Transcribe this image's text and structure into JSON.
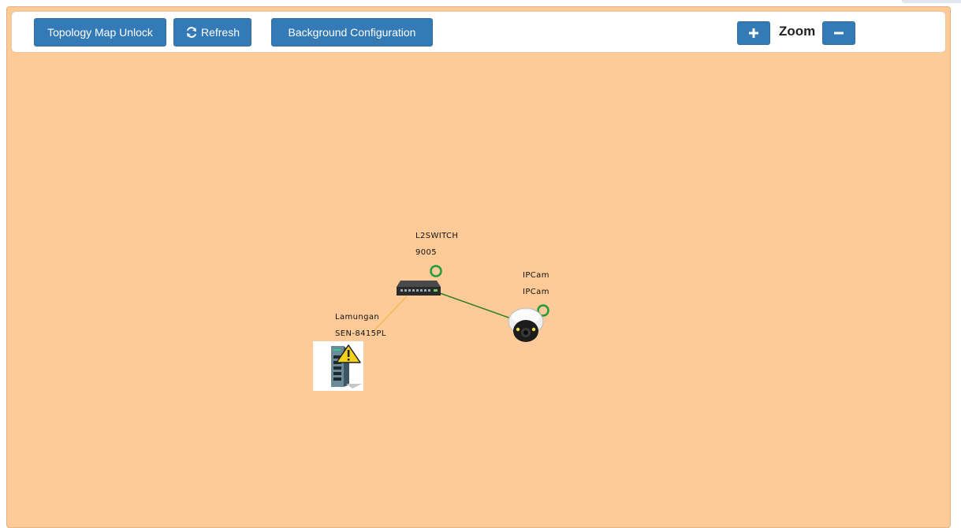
{
  "toolbar": {
    "topology_unlock_label": "Topology Map Unlock",
    "refresh_label": "Refresh",
    "background_config_label": "Background Configuration",
    "zoom_label": "Zoom",
    "zoom_in_icon": "plus-icon",
    "zoom_out_icon": "minus-icon",
    "refresh_icon": "refresh-icon"
  },
  "colors": {
    "canvas_background": "#fecb98",
    "button": "#337ab7",
    "status_ok": "#1e9b3c",
    "link_ok": "#2f7f1e",
    "link_warning": "#f5b955"
  },
  "nodes": [
    {
      "id": "l2switch",
      "name": "L2SWITCH",
      "model": "9005",
      "icon": "network-switch-icon",
      "status": "ok"
    },
    {
      "id": "ipcam",
      "name": "IPCam",
      "model": "IPCam",
      "icon": "dome-camera-icon",
      "status": "ok"
    },
    {
      "id": "lamungan",
      "name": "Lamungan",
      "model": "SEN-8415PL",
      "icon": "industrial-switch-icon",
      "status": "warning"
    }
  ],
  "links": [
    {
      "from": "l2switch",
      "to": "ipcam",
      "status": "ok"
    },
    {
      "from": "l2switch",
      "to": "lamungan",
      "status": "warning"
    }
  ]
}
